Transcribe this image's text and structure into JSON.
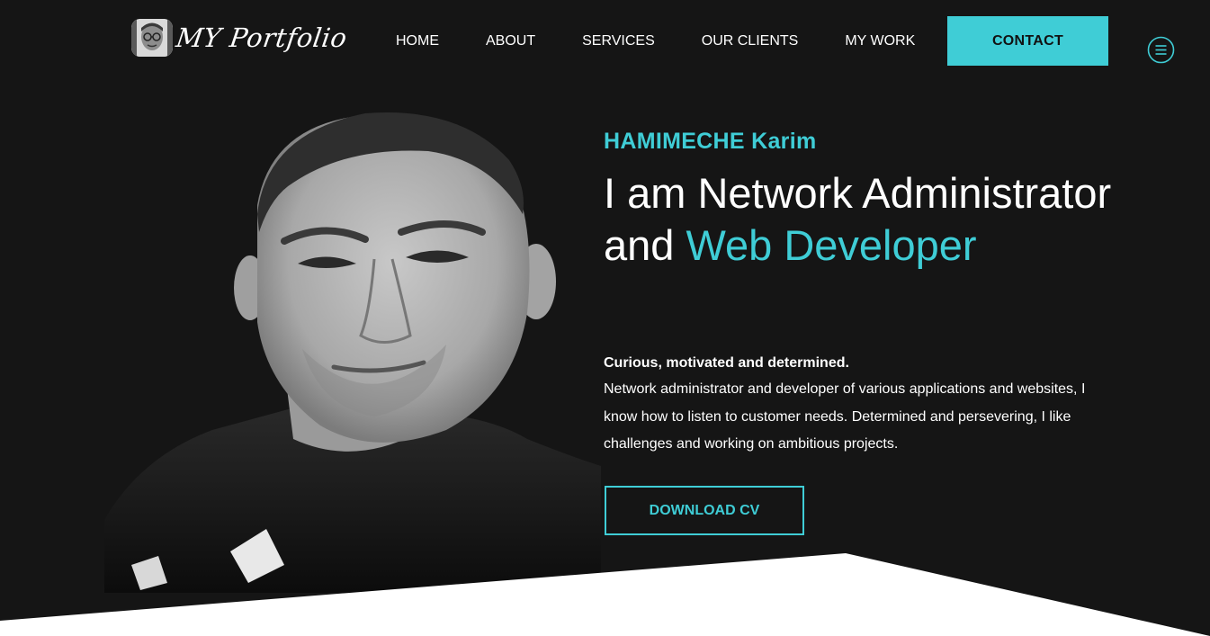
{
  "header": {
    "logo_text": "MY Portfolio",
    "nav": [
      {
        "label": "HOME"
      },
      {
        "label": "ABOUT"
      },
      {
        "label": "SERVICES"
      },
      {
        "label": "OUR CLIENTS"
      },
      {
        "label": "MY WORK"
      }
    ],
    "contact_label": "CONTACT"
  },
  "hero": {
    "name": "HAMIMECHE Karim",
    "title_prefix": "I am Network Administrator and ",
    "title_accent": "Web Developer",
    "tagline": "Curious, motivated and determined.",
    "bio": "Network administrator and developer of various applications and websites, I know how to listen to customer needs. Determined and persevering, I like challenges and working on ambitious projects.",
    "download_label": "DOWNLOAD CV"
  },
  "colors": {
    "background": "#151515",
    "accent": "#3fcdd6",
    "text": "#ffffff"
  },
  "icons": {
    "menu": "hamburger-circle-icon",
    "logo_avatar": "avatar-icon"
  }
}
